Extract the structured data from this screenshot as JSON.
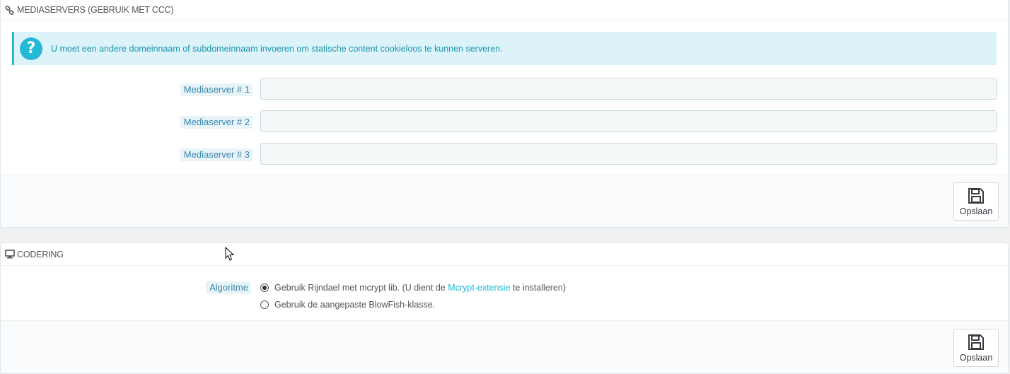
{
  "media_panel": {
    "title": "MEDIASERVERS (GEBRUIK MET CCC)",
    "title_icon": "link-icon",
    "info_message": "U moet een andere domeinnaam of subdomeinnaam invoeren om statische content cookieloos te kunnen serveren.",
    "fields": [
      {
        "label": "Mediaserver # 1",
        "value": ""
      },
      {
        "label": "Mediaserver # 2",
        "value": ""
      },
      {
        "label": "Mediaserver # 3",
        "value": ""
      }
    ],
    "save_label": "Opslaan"
  },
  "encoding_panel": {
    "title": "CODERING",
    "title_icon": "desktop-icon",
    "field_label": "Algoritme",
    "options": [
      {
        "text_before": "Gebruik Rijndael met mcrypt lib. (U dient de ",
        "link": "Mcrypt-extensie",
        "text_after": " te installeren)",
        "checked": true
      },
      {
        "text": "Gebruik de aangepaste BlowFish-klasse.",
        "checked": false
      }
    ],
    "save_label": "Opslaan"
  },
  "colors": {
    "accent": "#25b9d7",
    "info_bg": "#dcf4f9",
    "label_text": "#3586ae"
  }
}
